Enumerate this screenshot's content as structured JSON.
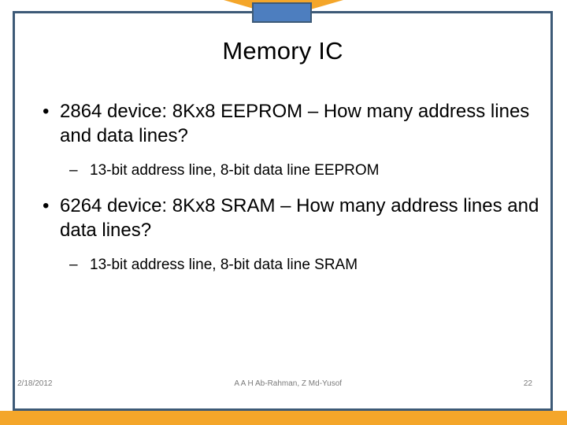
{
  "slide": {
    "title": "Memory IC",
    "page_number": "22",
    "colors": {
      "frame_border": "#3D5A77",
      "accent_orange": "#F4A62A",
      "accent_blue": "#4D7EBF",
      "body_text": "#000000",
      "footer_text": "#7A7A7A",
      "background": "#FFFFFF"
    }
  },
  "decoration": {
    "triangle_name": "orange-triangle-shape",
    "tab_name": "blue-tab-shape"
  },
  "body": {
    "bullets": [
      {
        "level1_marker": "•",
        "level1_text": "2864 device: 8Kx8 EEPROM – How many address lines and data lines?",
        "level2_marker": "–",
        "level2_text": "13-bit address line, 8-bit data line EEPROM"
      },
      {
        "level1_marker": "•",
        "level1_text": "6264 device: 8Kx8 SRAM – How many address lines and data lines?",
        "level2_marker": "–",
        "level2_text": "13-bit address line, 8-bit data line SRAM"
      }
    ]
  },
  "footer": {
    "date": "2/18/2012",
    "authors": "A A H Ab-Rahman, Z Md-Yusof",
    "page": "22"
  }
}
